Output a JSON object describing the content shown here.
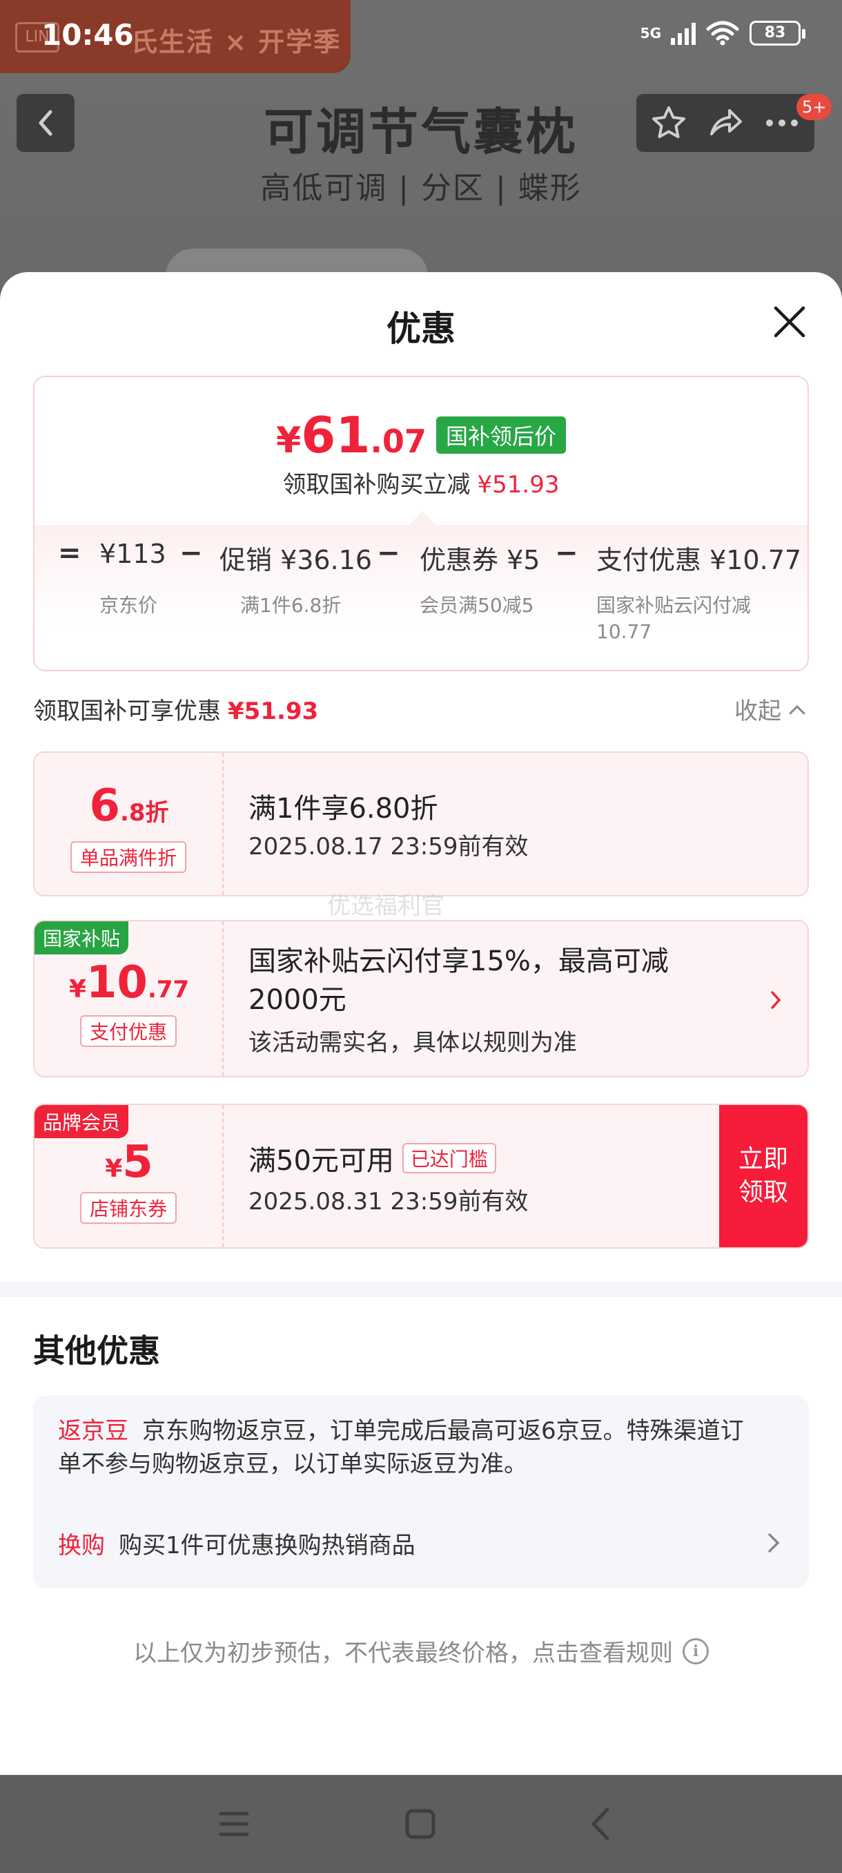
{
  "status_bar": {
    "time": "10:46",
    "network": "5G",
    "battery": "83"
  },
  "background": {
    "brand_logo": "LIN",
    "brand_text": "氏生活 × 开学季",
    "product_title": "可调节气囊枕",
    "product_subtitle": "高低可调 | 分区 | 蝶形",
    "cart_badge": "5+"
  },
  "sheet": {
    "title": "优惠",
    "summary": {
      "price_yen": "¥",
      "price_int": "61",
      "price_dec": ".07",
      "price_tag": "国补领后价",
      "subsidy_text": "领取国补购买立减",
      "subsidy_amount": "¥51.93",
      "calc": {
        "eq": "=",
        "jd_price": "¥113",
        "minus": "−",
        "promo": "促销 ¥36.16",
        "coupon": "优惠券 ¥5",
        "payment": "支付优惠 ¥10.77",
        "jd_price_label": "京东价",
        "promo_label": "满1件6.8折",
        "coupon_label": "会员满50减5",
        "payment_label": "国家补贴云闪付减 10.77"
      }
    },
    "available": {
      "label": "领取国补可享优惠",
      "amount": "¥51.93",
      "collapse": "收起"
    },
    "coupons": [
      {
        "value_big": "6",
        "value_small": ".8折",
        "label": "单品满件折",
        "title": "满1件享6.80折",
        "detail": "2025.08.17 23:59前有效"
      },
      {
        "corner": "国家补贴",
        "value_prefix": "¥",
        "value_big": "10",
        "value_small": ".77",
        "label": "支付优惠",
        "title": "国家补贴云闪付享15%，最高可减 2000元",
        "detail": "该活动需实名，具体以规则为准"
      },
      {
        "corner": "品牌会员",
        "value_prefix": "¥",
        "value_big": "5",
        "label": "店铺东券",
        "title": "满50元可用",
        "threshold": "已达门槛",
        "detail": "2025.08.31 23:59前有效",
        "cta": "立即领取"
      }
    ],
    "watermark": "优选福利官",
    "other": {
      "title": "其他优惠",
      "jingdou_tag": "返京豆",
      "jingdou_text": "京东购物返京豆，订单完成后最高可返6京豆。特殊渠道订单不参与购物返京豆，以订单实际返豆为准。",
      "swap_tag": "换购",
      "swap_text": "购买1件可优惠换购热销商品"
    },
    "footer_note": "以上仅为初步预估，不代表最终价格，点击查看规则",
    "info_glyph": "i"
  },
  "colors": {
    "accent": "#f0223a",
    "green_tag": "#28a745",
    "cta": "#f71c39"
  }
}
